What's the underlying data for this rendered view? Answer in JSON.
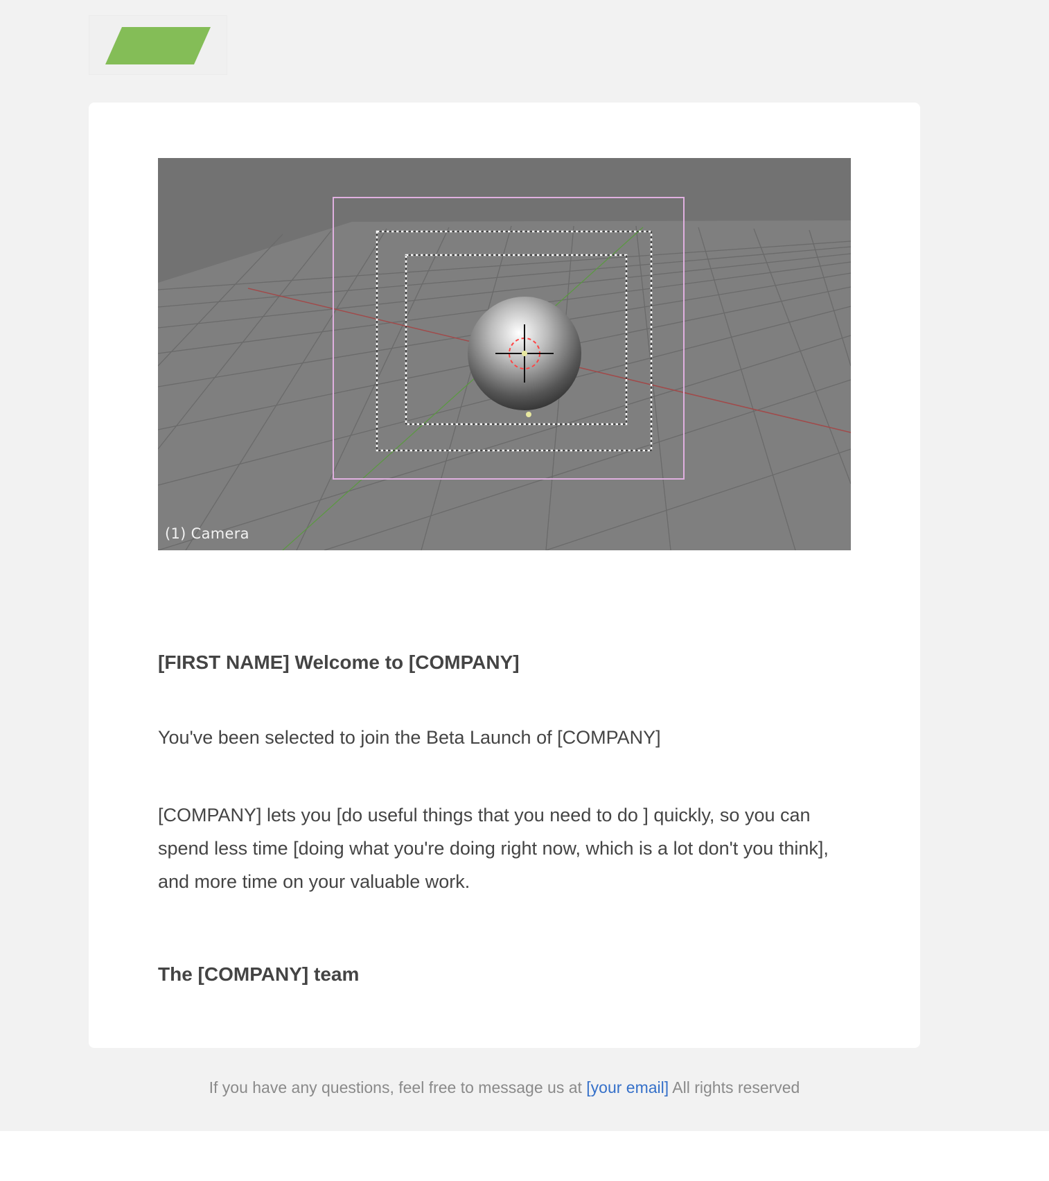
{
  "header": {
    "logo_name": "logo-parallelogram",
    "logo_color": "#84bd57"
  },
  "hero": {
    "caption": "(1) Camera"
  },
  "content": {
    "headline": "[FIRST NAME] Welcome to [COMPANY]",
    "paragraph_1": "You've been selected to join the Beta Launch of [COMPANY]",
    "paragraph_2": "[COMPANY] lets you [do useful things that you need to do ] quickly, so you can spend less time [doing what you're doing right now, which is a lot don't you think], and more time on your valuable work.",
    "signoff": "The [COMPANY] team"
  },
  "footer": {
    "text_before": "If you have any questions, feel free to message us at",
    "email_link": "[your email]",
    "text_after": "All rights reserved",
    "link_color": "#3570c9"
  }
}
